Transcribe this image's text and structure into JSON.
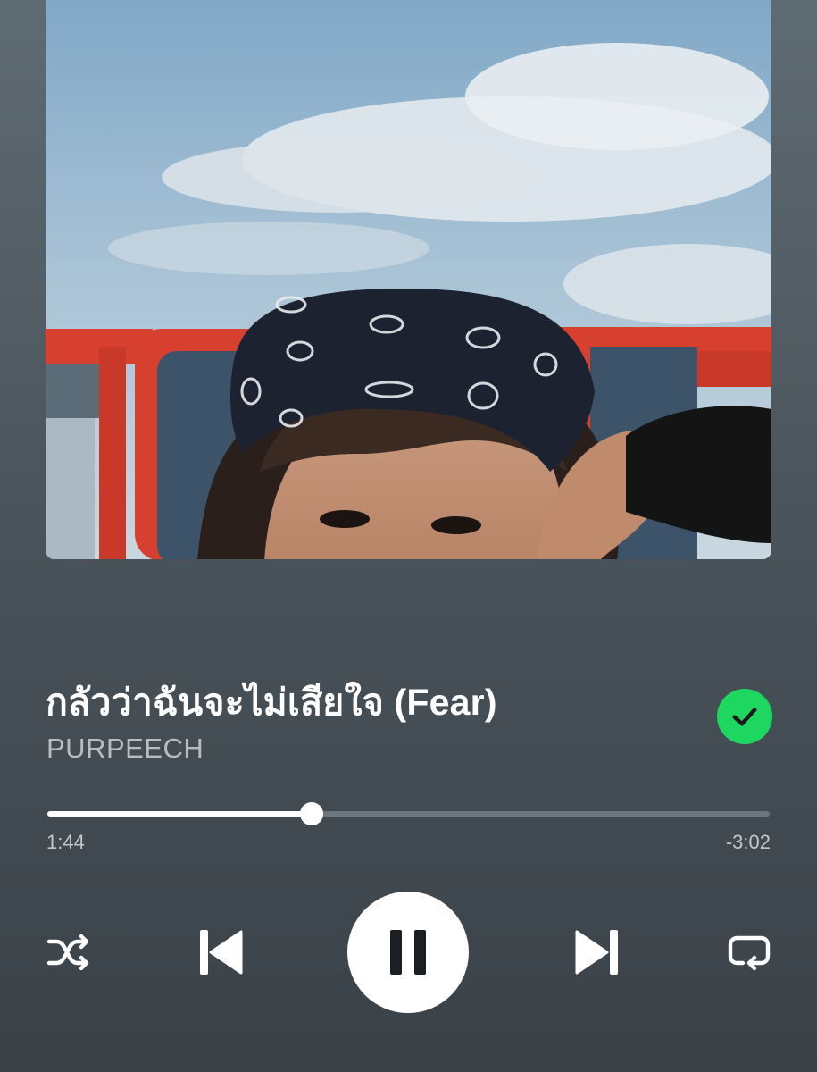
{
  "track": {
    "title": "กลัวว่าฉันจะไม่เสียใจ (Fear)",
    "artist": "PURPEECH",
    "liked": true
  },
  "playback": {
    "elapsed": "1:44",
    "remaining": "-3:02",
    "progress_fraction": 0.366,
    "state": "playing"
  },
  "controls": {
    "shuffle_icon": "shuffle-icon",
    "previous_icon": "skip-previous-icon",
    "play_pause_icon": "pause-icon",
    "next_icon": "skip-next-icon",
    "repeat_icon": "repeat-icon",
    "liked_icon": "check-circle-icon"
  },
  "colors": {
    "accent": "#1ed760",
    "background_top": "#5f6b73",
    "background_bottom": "#3a4248"
  }
}
